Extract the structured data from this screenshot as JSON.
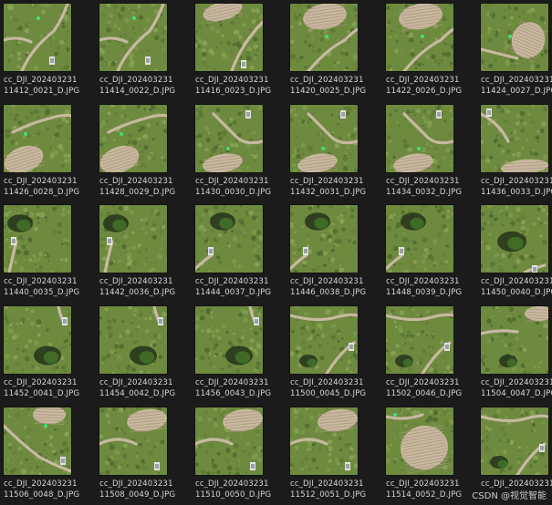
{
  "files": [
    {
      "line1": "cc_DJI_202403231",
      "line2": "11412_0021_D.JPG",
      "scene": "path-left"
    },
    {
      "line1": "cc_DJI_202403231",
      "line2": "11414_0022_D.JPG",
      "scene": "path-left"
    },
    {
      "line1": "cc_DJI_202403231",
      "line2": "11416_0023_D.JPG",
      "scene": "terrace-top-path"
    },
    {
      "line1": "cc_DJI_202403231",
      "line2": "11420_0025_D.JPG",
      "scene": "terrace-top"
    },
    {
      "line1": "cc_DJI_202403231",
      "line2": "11422_0026_D.JPG",
      "scene": "terrace-top"
    },
    {
      "line1": "cc_DJI_202403231",
      "line2": "11424_0027_D.JPG",
      "scene": "terrace-right"
    },
    {
      "line1": "cc_DJI_202403231",
      "line2": "11426_0028_D.JPG",
      "scene": "terrace-left"
    },
    {
      "line1": "cc_DJI_202403231",
      "line2": "11428_0029_D.JPG",
      "scene": "terrace-left"
    },
    {
      "line1": "cc_DJI_202403231",
      "line2": "11430_0030_D.JPG",
      "scene": "terrace-bottom"
    },
    {
      "line1": "cc_DJI_202403231",
      "line2": "11432_0031_D.JPG",
      "scene": "terrace-bottom"
    },
    {
      "line1": "cc_DJI_202403231",
      "line2": "11434_0032_D.JPG",
      "scene": "terrace-bottom"
    },
    {
      "line1": "cc_DJI_202403231",
      "line2": "11436_0033_D.JPG",
      "scene": "terrace-bottom-right"
    },
    {
      "line1": "cc_DJI_202403231",
      "line2": "11440_0035_D.JPG",
      "scene": "tree-left"
    },
    {
      "line1": "cc_DJI_202403231",
      "line2": "11442_0036_D.JPG",
      "scene": "tree-left"
    },
    {
      "line1": "cc_DJI_202403231",
      "line2": "11444_0037_D.JPG",
      "scene": "tree-top"
    },
    {
      "line1": "cc_DJI_202403231",
      "line2": "11446_0038_D.JPG",
      "scene": "tree-top"
    },
    {
      "line1": "cc_DJI_202403231",
      "line2": "11448_0039_D.JPG",
      "scene": "tree-top"
    },
    {
      "line1": "cc_DJI_202403231",
      "line2": "11450_0040_D.JPG",
      "scene": "tree-center"
    },
    {
      "line1": "cc_DJI_202403231",
      "line2": "11452_0041_D.JPG",
      "scene": "tree-bottom"
    },
    {
      "line1": "cc_DJI_202403231",
      "line2": "11454_0042_D.JPG",
      "scene": "tree-bottom"
    },
    {
      "line1": "cc_DJI_202403231",
      "line2": "11456_0043_D.JPG",
      "scene": "tree-bottom"
    },
    {
      "line1": "cc_DJI_202403231",
      "line2": "11500_0045_D.JPG",
      "scene": "path-right"
    },
    {
      "line1": "cc_DJI_202403231",
      "line2": "11502_0046_D.JPG",
      "scene": "path-right"
    },
    {
      "line1": "cc_DJI_202403231",
      "line2": "11504_0047_D.JPG",
      "scene": "terrace-corner"
    },
    {
      "line1": "cc_DJI_202403231",
      "line2": "11506_0048_D.JPG",
      "scene": "terrace-corner-left"
    },
    {
      "line1": "cc_DJI_202403231",
      "line2": "11508_0049_D.JPG",
      "scene": "terrace-top-right"
    },
    {
      "line1": "cc_DJI_202403231",
      "line2": "11510_0050_D.JPG",
      "scene": "terrace-top-right"
    },
    {
      "line1": "cc_DJI_202403231",
      "line2": "11512_0051_D.JPG",
      "scene": "terrace-top-right"
    },
    {
      "line1": "cc_DJI_202403231",
      "line2": "11514_0052_D.JPG",
      "scene": "terrace-bottom-big"
    },
    {
      "line1": "cc_DJI_202403231",
      "line2": "",
      "scene": "path-right"
    }
  ],
  "watermark": "CSDN @视觉智能",
  "colors": {
    "background": "#1b1b1b",
    "filename_text": "#d6d6d6",
    "vegetation": "#6f8a3e",
    "terrace": "#c9b89f",
    "path": "#c7b9a2"
  }
}
